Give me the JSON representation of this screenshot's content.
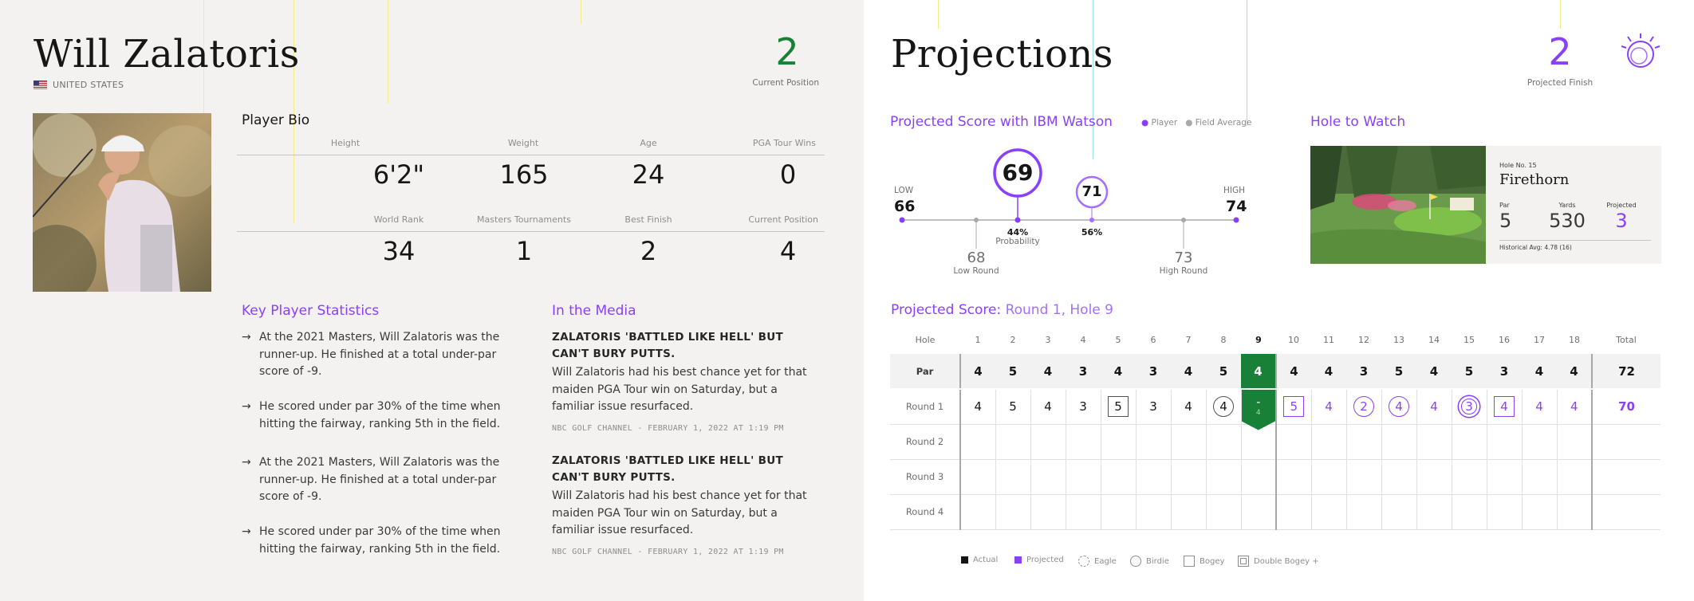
{
  "player": {
    "name": "Will Zalatoris",
    "country": "UNITED STATES",
    "current_position": "2",
    "current_position_label": "Current Position"
  },
  "bio": {
    "title": "Player Bio",
    "stats_row1": [
      {
        "label": "Height",
        "value": "6'2\""
      },
      {
        "label": "Weight",
        "value": "165"
      },
      {
        "label": "Age",
        "value": "24"
      },
      {
        "label": "PGA Tour Wins",
        "value": "0"
      }
    ],
    "stats_row2": [
      {
        "label": "World Rank",
        "value": "34"
      },
      {
        "label": "Masters Tournaments",
        "value": "1"
      },
      {
        "label": "Best Finish",
        "value": "2"
      },
      {
        "label": "Current Position",
        "value": "4"
      }
    ]
  },
  "key_stats": {
    "title": "Key Player Statistics",
    "items": [
      "At the 2021 Masters, Will Zalatoris was the runner-up. He finished at a total under-par score of -9.",
      "He scored under par 30% of the time when hitting the fairway, ranking 5th in the field.",
      "At the 2021 Masters, Will Zalatoris was the runner-up. He finished at a total under-par score of -9.",
      "He scored under par 30% of the time when hitting the fairway, ranking 5th in the field."
    ]
  },
  "media": {
    "title": "In the Media",
    "items": [
      {
        "headline": "ZALATORIS 'BATTLED LIKE HELL' BUT CAN'T BURY PUTTS.",
        "body": "Will Zalatoris had his best chance yet for that maiden PGA Tour win on Saturday, but a familiar issue resurfaced.",
        "meta": "NBC GOLF CHANNEL - FEBRUARY 1, 2022 AT 1:19 PM"
      },
      {
        "headline": "ZALATORIS 'BATTLED LIKE HELL' BUT CAN'T BURY PUTTS.",
        "body": "Will Zalatoris had his best chance yet for that maiden PGA Tour win on Saturday, but a familiar issue resurfaced.",
        "meta": "NBC GOLF CHANNEL - FEBRUARY 1, 2022 AT 1:19 PM"
      }
    ]
  },
  "projections": {
    "title": "Projections",
    "projected_finish": "2",
    "projected_finish_label": "Projected Finish",
    "score_title": "Projected Score with IBM Watson",
    "legend_player": "Player",
    "legend_field": "Field Average",
    "low_label": "LOW",
    "low_value": "66",
    "high_label": "HIGH",
    "high_value": "74",
    "player_score": "69",
    "player_prob": "44%",
    "player_prob_label": "Probability",
    "field_score": "71",
    "field_prob": "56%",
    "low_round": "68",
    "low_round_label": "Low Round",
    "high_round": "73",
    "high_round_label": "High Round",
    "score_range": {
      "min": 66,
      "max": 74
    }
  },
  "hole_to_watch": {
    "title": "Hole to Watch",
    "hole_no": "Hole No. 15",
    "name": "Firethorn",
    "par_label": "Par",
    "par": "5",
    "yards_label": "Yards",
    "yards": "530",
    "projected_label": "Projected",
    "projected": "3",
    "historical": "Historical Avg: 4.78 (16)"
  },
  "scorecard": {
    "title_prefix": "Projected Score:",
    "title_suffix": "Round 1, Hole 9",
    "hole_label": "Hole",
    "total_label": "Total",
    "holes": [
      "1",
      "2",
      "3",
      "4",
      "5",
      "6",
      "7",
      "8",
      "9",
      "10",
      "11",
      "12",
      "13",
      "14",
      "15",
      "16",
      "17",
      "18"
    ],
    "par_label": "Par",
    "par": [
      "4",
      "5",
      "4",
      "3",
      "4",
      "3",
      "4",
      "5",
      "4",
      "4",
      "4",
      "3",
      "5",
      "4",
      "5",
      "3",
      "4",
      "4"
    ],
    "par_total": "72",
    "round1_label": "Round 1",
    "round1": [
      "4",
      "5",
      "4",
      "3",
      "5",
      "3",
      "4",
      "4",
      "-",
      "5",
      "4",
      "2",
      "4",
      "4",
      "3",
      "4",
      "4",
      "4"
    ],
    "round1_sub_current": "4",
    "round1_total": "70",
    "round_labels": [
      "Round 2",
      "Round 3",
      "Round 4"
    ]
  },
  "legend": [
    "Actual",
    "Projected",
    "Eagle",
    "Birdie",
    "Bogey",
    "Double Bogey +"
  ],
  "colors": {
    "purple": "#8a3ffc",
    "green": "#198038",
    "yellow_line": "#f1e66b",
    "cyan_line": "#9ddbe3"
  }
}
